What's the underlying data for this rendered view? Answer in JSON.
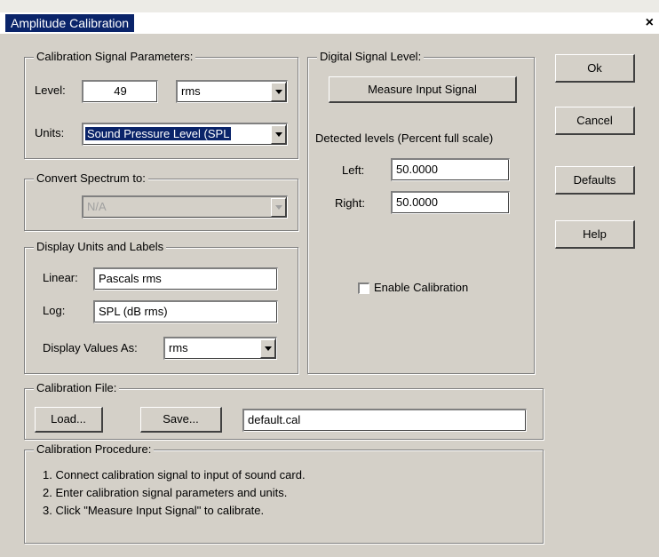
{
  "window": {
    "title": "Amplitude Calibration",
    "close_glyph": "×"
  },
  "calib_params": {
    "title": "Calibration Signal Parameters:",
    "level_label": "Level:",
    "level_value": "49",
    "level_unit": "rms",
    "units_label": "Units:",
    "units_value": "Sound Pressure Level (SPL"
  },
  "convert": {
    "title": "Convert Spectrum to:",
    "value": "N/A"
  },
  "display_units": {
    "title": "Display Units and Labels",
    "linear_label": "Linear:",
    "linear_value": "Pascals rms",
    "log_label": "Log:",
    "log_value": "SPL (dB rms)",
    "values_as_label": "Display Values As:",
    "values_as_value": "rms"
  },
  "digital": {
    "title": "Digital Signal Level:",
    "measure_button": "Measure Input Signal",
    "detected_label": "Detected levels (Percent full scale)",
    "left_label": "Left:",
    "left_value": "50.0000",
    "right_label": "Right:",
    "right_value": "50.0000",
    "enable_label": "Enable Calibration",
    "enable_checked": false
  },
  "buttons": {
    "ok": "Ok",
    "cancel": "Cancel",
    "defaults": "Defaults",
    "help": "Help"
  },
  "file": {
    "title": "Calibration File:",
    "load_button": "Load...",
    "save_button": "Save...",
    "filename": "default.cal"
  },
  "procedure": {
    "title": "Calibration Procedure:",
    "steps": [
      "1. Connect calibration signal to input of sound card.",
      "2. Enter calibration signal parameters and units.",
      "3. Click \"Measure Input Signal\" to calibrate."
    ]
  },
  "colors": {
    "titlebar": "#0a246a",
    "face": "#d4d0c8"
  }
}
